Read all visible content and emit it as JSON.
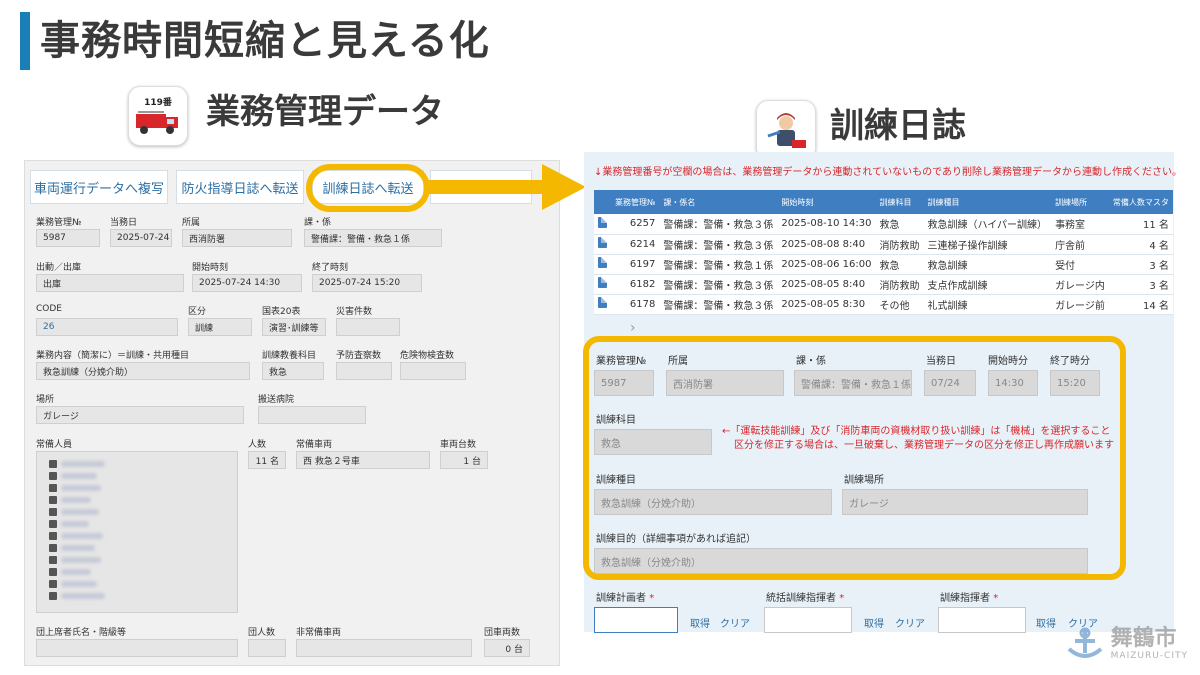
{
  "slide": {
    "title": "事務時間短縮と見える化"
  },
  "left": {
    "heading": "業務管理データ",
    "icon_text": "119番",
    "tabs": [
      "車両運行データへ複写",
      "防火指導日誌へ転送",
      "訓練日誌へ転送"
    ],
    "fields": {
      "business_no_label": "業務管理№",
      "business_no": "5987",
      "duty_day_label": "当務日",
      "duty_day": "2025-07-24",
      "affiliation_label": "所属",
      "affiliation": "西消防署",
      "section_label": "課・係",
      "section": "警備課：警備・救急１係",
      "dispatch_label": "出動／出庫",
      "dispatch": "出庫",
      "start_label": "開始時刻",
      "start": "2025-07-24 14:30",
      "end_label": "終了時刻",
      "end": "2025-07-24 15:20",
      "code_label": "CODE",
      "code": "26",
      "kubun_label": "区分",
      "kubun": "訓練",
      "kokuhyo_label": "国表20表",
      "kokuhyo": "演習･訓練等",
      "disaster_label": "災害件数",
      "disaster": "",
      "content_label": "業務内容（簡潔に）＝訓練・共用種目",
      "content": "救急訓練（分娩介助）",
      "subject_label": "訓練教養科目",
      "subject": "救急",
      "prevent_label": "予防査察数",
      "prevent": "",
      "hazard_label": "危険物検査数",
      "hazard": "",
      "place_label": "場所",
      "place": "ガレージ",
      "hospital_label": "搬送病院",
      "hospital": "",
      "staff_label": "常備人員",
      "people_label": "人数",
      "people": "11 名",
      "vehicle_label": "常備車両",
      "vehicle": "西 救急２号車",
      "vehicle_count_label": "車両台数",
      "vehicle_count": "1 台",
      "leader_label": "団上席者氏名・階級等",
      "leader": "",
      "group_people_label": "団人数",
      "group_people": "",
      "nonstd_vehicle_label": "非常備車両",
      "nonstd_vehicle": "",
      "group_vehicle_label": "団車両数",
      "group_vehicle": "0 台"
    }
  },
  "right": {
    "heading": "訓練日誌",
    "warning": "↓業務管理番号が空欄の場合は、業務管理データから連動されていないものであり削除し業務管理データから連動し作成ください。",
    "columns": [
      "業務管理№",
      "課・係名",
      "開始時刻",
      "訓練科目",
      "訓練種目",
      "訓練場所",
      "常備人数マスタ"
    ],
    "rows": [
      [
        "6257",
        "警備課：警備・救急３係",
        "2025-08-10 14:30",
        "救急",
        "救急訓練（ハイパー訓練）",
        "事務室",
        "11 名"
      ],
      [
        "6214",
        "警備課：警備・救急３係",
        "2025-08-08 8:40",
        "消防救助",
        "三連梯子操作訓練",
        "庁舎前",
        "4 名"
      ],
      [
        "6197",
        "警備課：警備・救急１係",
        "2025-08-06 16:00",
        "救急",
        "救急訓練",
        "受付",
        "3 名"
      ],
      [
        "6182",
        "警備課：警備・救急３係",
        "2025-08-05 8:40",
        "消防救助",
        "支点作成訓練",
        "ガレージ内",
        "3 名"
      ],
      [
        "6178",
        "警備課：警備・救急３係",
        "2025-08-05 8:30",
        "その他",
        "礼式訓練",
        "ガレージ前",
        "14 名"
      ]
    ],
    "form": {
      "business_no_label": "業務管理№",
      "business_no": "5987",
      "affiliation_label": "所属",
      "affiliation": "西消防署",
      "section_label": "課・係",
      "section": "警備課：警備・救急１係",
      "duty_day_label": "当務日",
      "duty_day": "07/24",
      "start_label": "開始時分",
      "start": "14:30",
      "end_label": "終了時分",
      "end": "15:20",
      "subject_label": "訓練科目",
      "subject": "救急",
      "note1": "←「運転技能訓練」及び「消防車両の資機材取り扱い訓練」は「機械」を選択すること",
      "note2": "区分を修正する場合は、一旦破棄し、業務管理データの区分を修正し再作成願います",
      "type_label": "訓練種目",
      "type": "救急訓練（分娩介助）",
      "place_label": "訓練場所",
      "place": "ガレージ",
      "purpose_label": "訓練目的（詳細事項があれば追記）",
      "purpose": "救急訓練（分娩介助）",
      "planner_label": "訓練計画者",
      "overall_label": "統括訓練指揮者",
      "commander_label": "訓練指揮者",
      "required": "*",
      "get": "取得",
      "clear": "クリア"
    }
  },
  "watermark": {
    "name": "舞鶴市",
    "roman": "MAIZURU-CITY"
  },
  "colors": {
    "accent": "#1a7fb5",
    "highlight": "#f5b800",
    "header_blue": "#3f7fc1",
    "warning_red": "#d8262b"
  }
}
